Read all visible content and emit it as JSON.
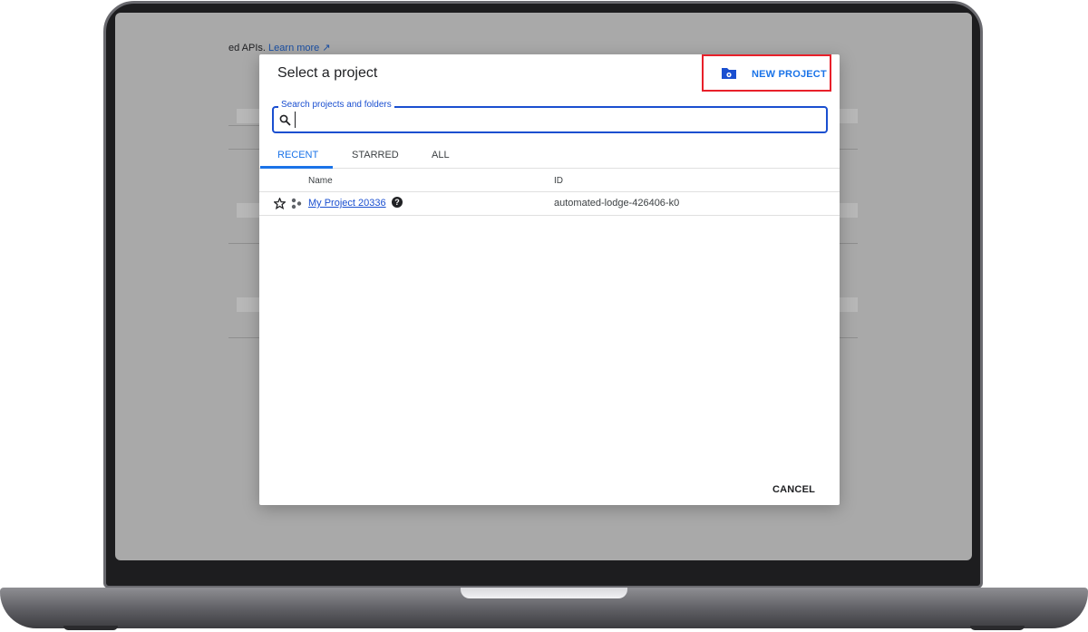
{
  "background": {
    "text": "ed APIs.",
    "link": "Learn more"
  },
  "dialog": {
    "title": "Select a project",
    "new_project_label": "NEW PROJECT",
    "search": {
      "label": "Search projects and folders",
      "value": ""
    },
    "tabs": [
      {
        "label": "RECENT",
        "active": true
      },
      {
        "label": "STARRED",
        "active": false
      },
      {
        "label": "ALL",
        "active": false
      }
    ],
    "columns": {
      "name": "Name",
      "id": "ID"
    },
    "rows": [
      {
        "name": "My Project 20336",
        "id": "automated-lodge-426406-k0"
      }
    ],
    "cancel_label": "CANCEL"
  },
  "colors": {
    "accent": "#1a73e8",
    "highlight": "#e8202a",
    "overlay": "#a9a9a9"
  },
  "icons": {
    "new_project": "folder-gear-icon",
    "search": "search-icon",
    "star": "star-outline-icon",
    "org": "organization-icon",
    "help": "help-icon"
  }
}
